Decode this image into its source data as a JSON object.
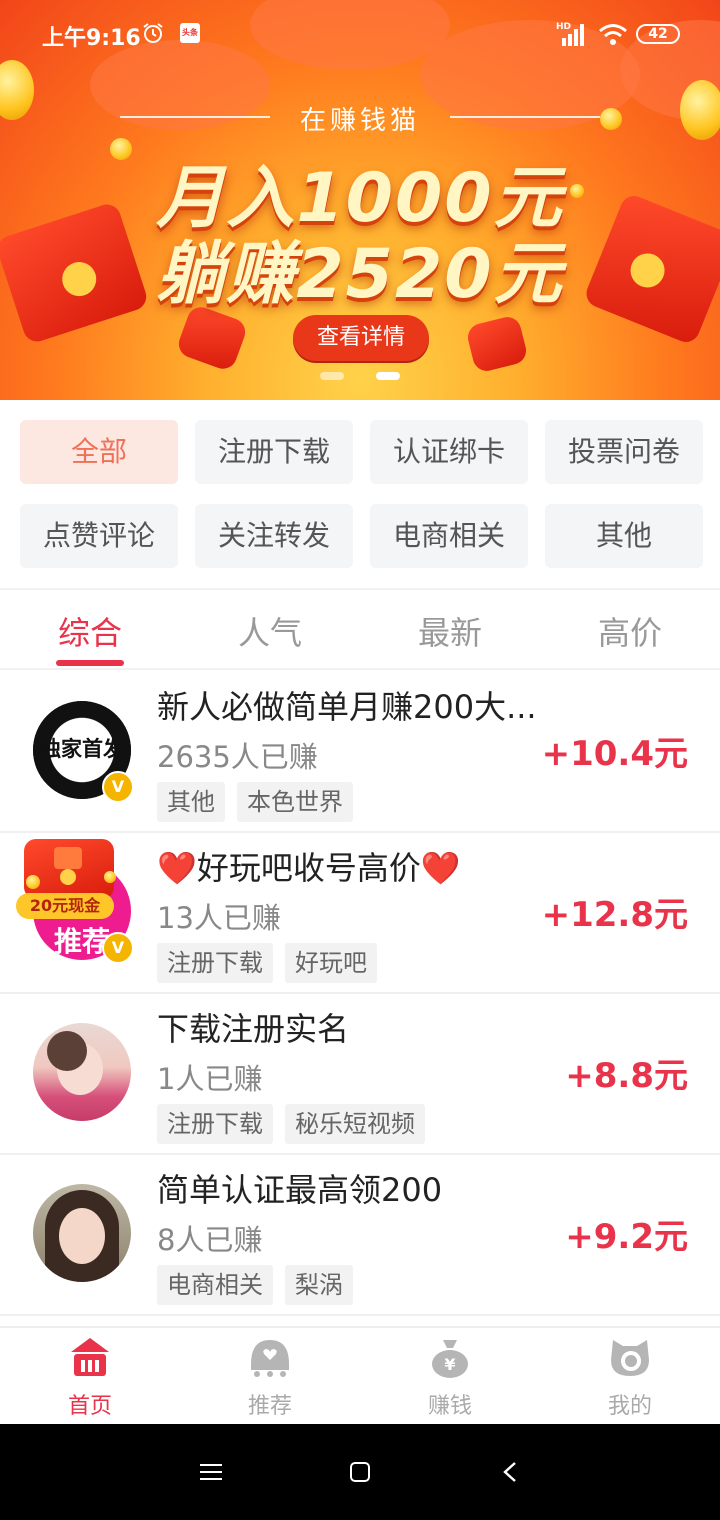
{
  "status_bar": {
    "time": "上午9:16",
    "app_badge": "头条",
    "network": "HD",
    "battery": "42"
  },
  "banner": {
    "subtitle": "在赚钱猫",
    "headline_1": "月入1000元",
    "headline_2": "躺赚2520元",
    "button": "查看详情",
    "active_dot": 1
  },
  "categories": [
    "全部",
    "注册下载",
    "认证绑卡",
    "投票问卷",
    "点赞评论",
    "关注转发",
    "电商相关",
    "其他"
  ],
  "sort_tabs": [
    "综合",
    "人气",
    "最新",
    "高价"
  ],
  "tasks": [
    {
      "title": "新人必做简单月赚200大...",
      "count": "2635人已赚",
      "tags": [
        "其他",
        "本色世界"
      ],
      "reward": "+10.4元",
      "avatar_text": "独家首发"
    },
    {
      "title": "❤️好玩吧收号高价❤️",
      "count": "13人已赚",
      "tags": [
        "注册下载",
        "好玩吧"
      ],
      "reward": "+12.8元",
      "avatar_text": "推荐",
      "promo": "20元现金"
    },
    {
      "title": "下载注册实名",
      "count": "1人已赚",
      "tags": [
        "注册下载",
        "秘乐短视频"
      ],
      "reward": "+8.8元"
    },
    {
      "title": "简单认证最高领200",
      "count": "8人已赚",
      "tags": [
        "电商相关",
        "梨涡"
      ],
      "reward": "+9.2元"
    }
  ],
  "bottom_nav": [
    {
      "label": "首页",
      "icon": "home-icon"
    },
    {
      "label": "推荐",
      "icon": "recommend-icon"
    },
    {
      "label": "赚钱",
      "icon": "money-bag-icon"
    },
    {
      "label": "我的",
      "icon": "profile-icon"
    }
  ],
  "colors": {
    "accent": "#e8334a",
    "banner_red": "#f2451a",
    "category_active_bg": "#fde7e1"
  }
}
